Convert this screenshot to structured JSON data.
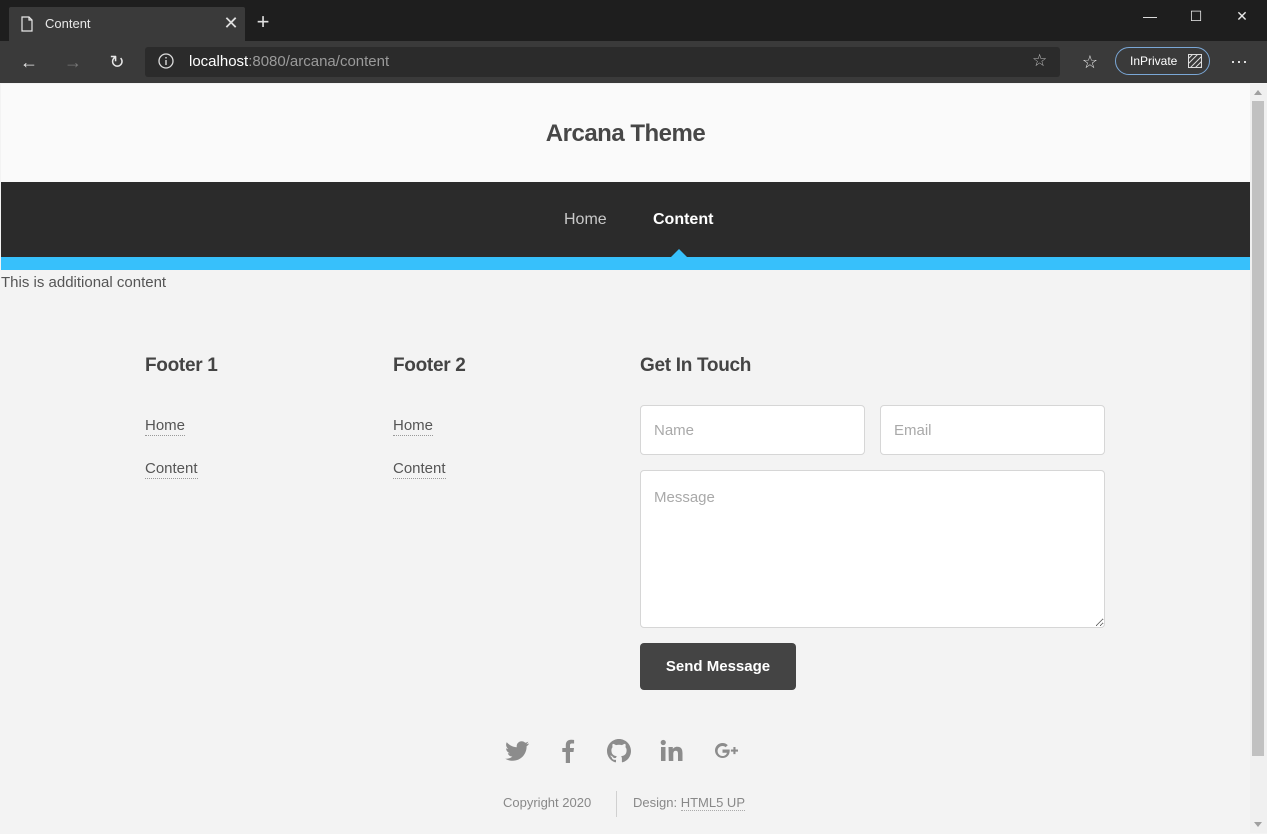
{
  "browser": {
    "tab_title": "Content",
    "url_host": "localhost",
    "url_rest": ":8080/arcana/content",
    "inprivate_label": "InPrivate",
    "icons": {
      "tab": "page-icon",
      "close": "close-icon",
      "new_tab": "plus-icon",
      "back": "arrow-left-icon",
      "forward": "arrow-right-icon",
      "refresh": "refresh-icon",
      "info": "info-icon",
      "favorite": "star-icon",
      "favorites": "favorites-list-icon",
      "more": "more-icon"
    }
  },
  "site": {
    "title": "Arcana Theme",
    "nav": {
      "home": "Home",
      "content": "Content"
    },
    "body_text": "This is additional content"
  },
  "footer": {
    "col1": {
      "heading": "Footer 1",
      "links": [
        "Home",
        "Content"
      ]
    },
    "col2": {
      "heading": "Footer 2",
      "links": [
        "Home",
        "Content"
      ]
    },
    "contact": {
      "heading": "Get In Touch",
      "name_placeholder": "Name",
      "email_placeholder": "Email",
      "message_placeholder": "Message",
      "send_label": "Send Message"
    },
    "social": [
      "twitter-icon",
      "facebook-icon",
      "github-icon",
      "linkedin-icon",
      "google-plus-icon"
    ],
    "copyright": "Copyright 2020",
    "design_label": "Design:",
    "design_link": "HTML5 UP"
  },
  "colors": {
    "accent": "#37c0fb",
    "nav_bg": "#2b2b2b",
    "button_bg": "#444444"
  }
}
